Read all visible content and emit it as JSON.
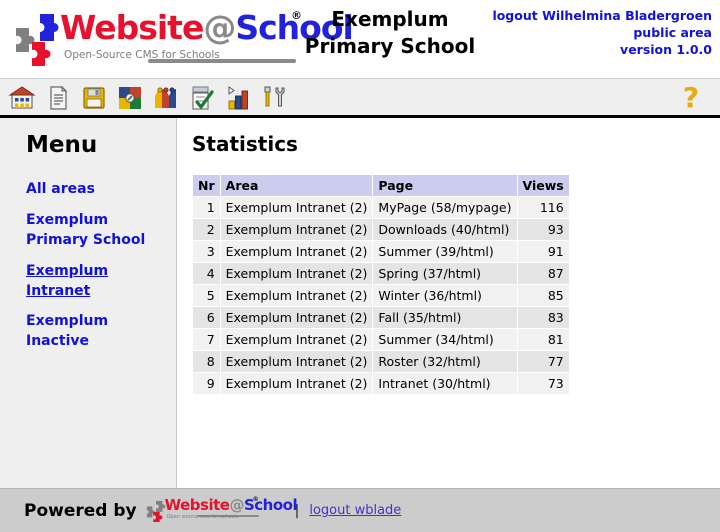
{
  "header": {
    "logo": {
      "word_web": "Website",
      "word_at": "@",
      "word_school": "School",
      "tagline": "Open-Source CMS for Schools",
      "registered_mark": "®"
    },
    "school_title_line1": "Exemplum",
    "school_title_line2": "Primary School",
    "right_lines": [
      "logout Wilhelmina Bladergroen",
      "public area",
      "version 1.0.0"
    ],
    "right_text_color": "#1111dd"
  },
  "toolbar": {
    "icons": [
      {
        "name": "school-home-icon",
        "title": "Home"
      },
      {
        "name": "page-document-icon",
        "title": "Pages"
      },
      {
        "name": "save-floppy-icon",
        "title": "Save"
      },
      {
        "name": "modules-puzzle-icon",
        "title": "Modules"
      },
      {
        "name": "users-people-icon",
        "title": "Users"
      },
      {
        "name": "checklist-form-icon",
        "title": "Forms"
      },
      {
        "name": "statistics-barchart-icon",
        "title": "Statistics"
      },
      {
        "name": "tools-settings-icon",
        "title": "Tools"
      }
    ],
    "help_glyph": "?",
    "help_color": "#E9A913"
  },
  "sidebar": {
    "title": "Menu",
    "items": [
      {
        "label": "All areas",
        "current": false
      },
      {
        "label": "Exemplum Primary School",
        "current": false
      },
      {
        "label": "Exemplum Intranet",
        "current": true
      },
      {
        "label": "Exemplum Inactive",
        "current": false
      }
    ],
    "link_color": "#1111dd"
  },
  "main": {
    "page_title": "Statistics",
    "table": {
      "headers": [
        "Nr",
        "Area",
        "Page",
        "Views"
      ],
      "header_bg": "#ccccee",
      "rows": [
        {
          "nr": "1",
          "area": "Exemplum Intranet (2)",
          "page": "MyPage (58/mypage)",
          "views": "116"
        },
        {
          "nr": "2",
          "area": "Exemplum Intranet (2)",
          "page": "Downloads (40/html)",
          "views": "93"
        },
        {
          "nr": "3",
          "area": "Exemplum Intranet (2)",
          "page": "Summer (39/html)",
          "views": "91"
        },
        {
          "nr": "4",
          "area": "Exemplum Intranet (2)",
          "page": "Spring (37/html)",
          "views": "87"
        },
        {
          "nr": "5",
          "area": "Exemplum Intranet (2)",
          "page": "Winter (36/html)",
          "views": "85"
        },
        {
          "nr": "6",
          "area": "Exemplum Intranet (2)",
          "page": "Fall (35/html)",
          "views": "83"
        },
        {
          "nr": "7",
          "area": "Exemplum Intranet (2)",
          "page": "Summer (34/html)",
          "views": "81"
        },
        {
          "nr": "8",
          "area": "Exemplum Intranet (2)",
          "page": "Roster (32/html)",
          "views": "77"
        },
        {
          "nr": "9",
          "area": "Exemplum Intranet (2)",
          "page": "Intranet (30/html)",
          "views": "73"
        }
      ]
    }
  },
  "footer": {
    "powered_by": "Powered by",
    "logo": {
      "word_web": "Website",
      "word_at": "@",
      "word_school": "School",
      "tagline": "Open source cms for schools",
      "registered_mark": "®"
    },
    "separator": "|",
    "logout_link": "logout wblade",
    "background": "#cccccc"
  }
}
